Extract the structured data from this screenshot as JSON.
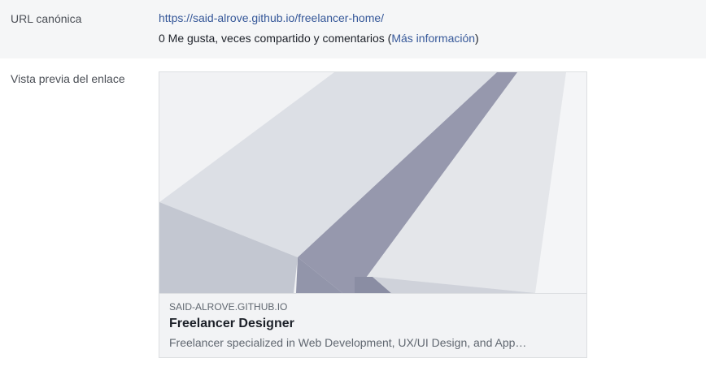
{
  "canonical": {
    "label": "URL canónica",
    "url": "https://said-alrove.github.io/freelancer-home/",
    "stats_prefix": "0 Me gusta, veces compartido y comentarios (",
    "more_info_link": "Más información",
    "stats_suffix": ")"
  },
  "preview": {
    "label": "Vista previa del enlace",
    "domain": "SAID-ALROVE.GITHUB.IO",
    "title": "Freelancer Designer",
    "description": "Freelancer specialized in Web Development, UX/UI Design, and App…",
    "image_icon": "paper-plane-image"
  }
}
